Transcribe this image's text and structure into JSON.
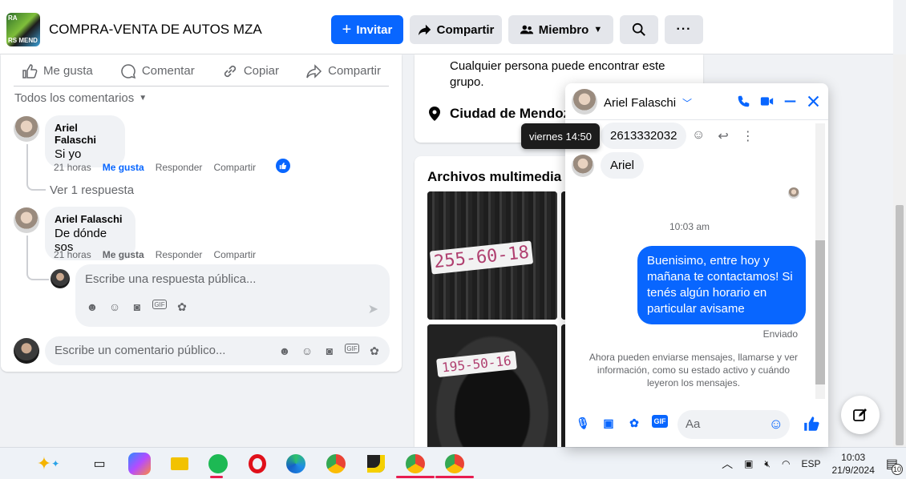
{
  "header": {
    "group_name": "COMPRA-VENTA DE AUTOS MZA",
    "invite": "Invitar",
    "share": "Compartir",
    "member": "Miembro",
    "more": "···"
  },
  "post_actions": {
    "like": "Me gusta",
    "comment": "Comentar",
    "copy": "Copiar",
    "share": "Compartir"
  },
  "comments_filter": "Todos los comentarios",
  "comments": [
    {
      "author": "Ariel Falaschi",
      "text": "Si yo",
      "time": "21 horas",
      "like": "Me gusta",
      "reply": "Responder",
      "share": "Compartir"
    },
    {
      "author": "Ariel Falaschi",
      "text": "De dónde sos",
      "time": "21 horas",
      "like": "Me gusta",
      "reply": "Responder",
      "share": "Compartir"
    }
  ],
  "view_replies": "Ver 1 respuesta",
  "reply_placeholder": "Escribe una respuesta pública...",
  "comment_placeholder": "Escribe un comentario público...",
  "about": {
    "text": "Cualquier persona puede encontrar este grupo.",
    "location": "Ciudad de Mendoz"
  },
  "media": {
    "title": "Archivos multimedia re",
    "tire_labels": [
      "255-60-18",
      "195-50-16"
    ]
  },
  "tooltip": "viernes 14:50",
  "chat": {
    "name": "Ariel Falaschi",
    "messages_in": [
      "2613332032",
      "Ariel"
    ],
    "timestamp": "10:03 am",
    "message_out": "Buenisimo, entre hoy y mañana te contactamos! Si tenés algún horario en particular avisame",
    "status": "Enviado",
    "notice": "Ahora pueden enviarse mensajes, llamarse y ver información, como su estado activo y cuándo leyeron los mensajes.",
    "input_placeholder": "Aa",
    "gif": "GIF"
  },
  "taskbar": {
    "language": "ESP",
    "time": "10:03",
    "date": "21/9/2024",
    "notifications": "10"
  },
  "colors": {
    "accent": "#0866ff",
    "text_secondary": "#65676b",
    "background": "#f0f2f5"
  }
}
